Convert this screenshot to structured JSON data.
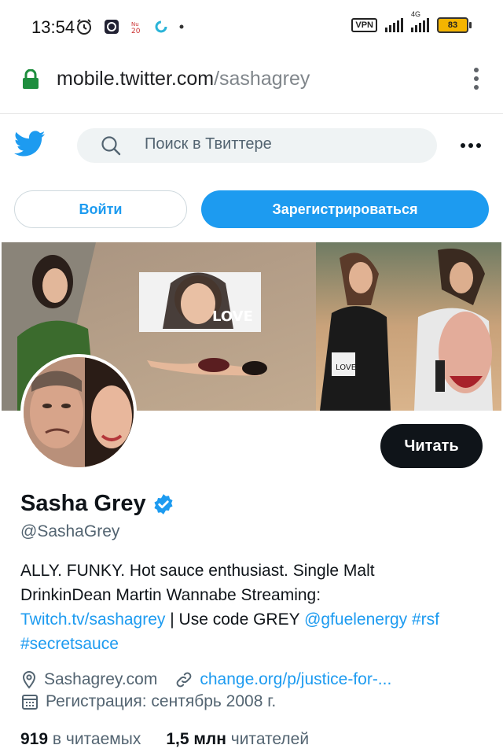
{
  "status_bar": {
    "time": "13:54",
    "vpn": "VPN",
    "network": "4G",
    "battery": "83"
  },
  "browser": {
    "url_host": "mobile.twitter.com",
    "url_path": "/sashagrey"
  },
  "header": {
    "search_placeholder": "Поиск в Твиттере"
  },
  "auth": {
    "login": "Войти",
    "signup": "Зарегистрироваться"
  },
  "profile": {
    "follow_button": "Читать",
    "name": "Sasha Grey",
    "handle": "@SashaGrey",
    "bio_line1": "ALLY. FUNKY. Hot sauce enthusiast. Single Malt",
    "bio_line2": "DrinkinDean Martin Wannabe Streaming:",
    "bio_link_twitch": "Twitch.tv/sashagrey",
    "bio_sep": " | Use code GREY ",
    "bio_mention": "@gfuelenergy",
    "bio_tag_rsf": "#rsf",
    "bio_tag_secretsauce": "#secretsauce",
    "location": "Sashagrey.com",
    "website": "change.org/p/justice-for-...",
    "joined": "Регистрация: сентябрь 2008 г.",
    "following_count": "919",
    "following_label": "в читаемых",
    "followers_count": "1,5 млн",
    "followers_label": "читателей",
    "banner_text": "LOVE"
  },
  "colors": {
    "accent": "#1d9bf0",
    "text": "#0f1419",
    "muted": "#536471"
  }
}
